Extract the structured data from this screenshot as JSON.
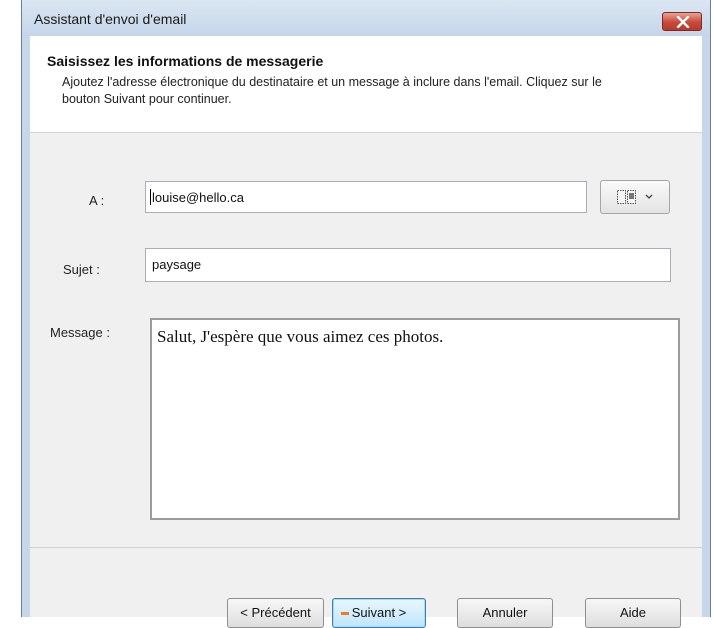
{
  "window": {
    "title": "Assistant d'envoi d'email"
  },
  "header": {
    "title": "Saisissez les informations de messagerie",
    "description": "Ajoutez l'adresse électronique du destinataire et un message à inclure dans l'email. Cliquez sur le bouton Suivant pour continuer."
  },
  "form": {
    "to_label": "A :",
    "to_value": "louise@hello.ca",
    "subject_label": "Sujet :",
    "subject_value": "paysage",
    "message_label": "Message :",
    "message_value": "Salut, J'espère que vous aimez ces photos."
  },
  "buttons": {
    "previous": "< Précédent",
    "next": "Suivant >",
    "cancel": "Annuler",
    "help": "Aide"
  },
  "icons": {
    "close": "close-icon",
    "address_book": "address-book-icon",
    "dropdown": "chevron-down-icon"
  },
  "colors": {
    "close_button": "#c8483a",
    "default_button_border": "#3c7fb1"
  }
}
